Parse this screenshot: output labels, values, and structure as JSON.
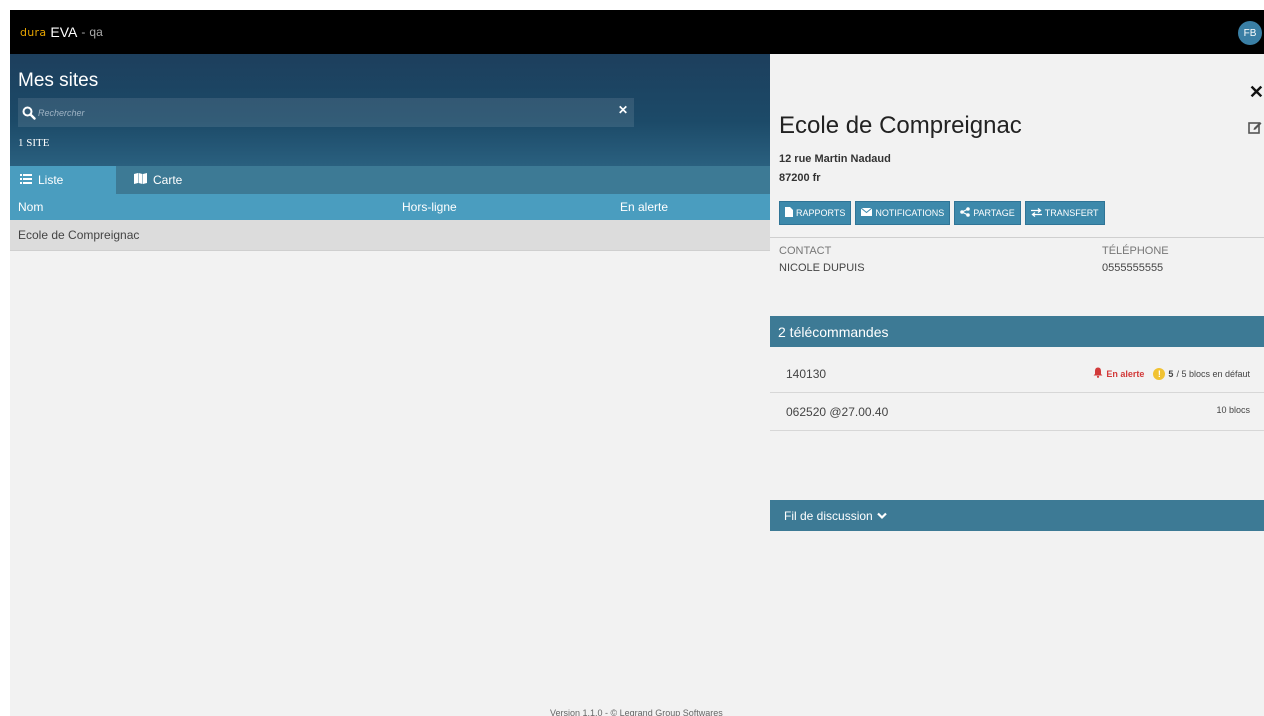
{
  "topbar": {
    "logo_text": "dura",
    "app_name": "EVA",
    "separator": "-",
    "env": "qa",
    "avatar_initials": "FB"
  },
  "sites": {
    "title": "Mes sites",
    "search_placeholder": "Rechercher",
    "search_value": "",
    "count_label": "1 SITE",
    "tabs": [
      {
        "label": "Liste",
        "icon": "list-icon",
        "active": true
      },
      {
        "label": "Carte",
        "icon": "map-icon",
        "active": false
      }
    ],
    "columns": [
      "Nom",
      "Hors-ligne",
      "En alerte"
    ],
    "rows": [
      {
        "name": "Ecole de Compreignac",
        "offline": "",
        "alert": ""
      }
    ],
    "footer": "Version 1.1.0 - © Legrand Group Softwares"
  },
  "detail": {
    "title": "Ecole de Compreignac",
    "address_line1": "12 rue Martin Nadaud",
    "address_line2": "87200 fr",
    "actions": [
      {
        "label": "RAPPORTS",
        "icon": "file-icon"
      },
      {
        "label": "NOTIFICATIONS",
        "icon": "envelope-icon"
      },
      {
        "label": "PARTAGE",
        "icon": "share-icon"
      },
      {
        "label": "TRANSFERT",
        "icon": "transfer-icon"
      }
    ],
    "contact_label": "CONTACT",
    "contact_value": "NICOLE DUPUIS",
    "phone_label": "TÉLÉPHONE",
    "phone_value": "0555555555",
    "remotes_header": "2 télécommandes",
    "remotes": [
      {
        "id": "140130",
        "alert_label": "En alerte",
        "warn_symbol": "!",
        "fault_count": "5",
        "fault_text": "/ 5 blocs en défaut"
      },
      {
        "id": "062520 @27.00.40",
        "blocks": "10 blocs"
      }
    ],
    "discussion_label": "Fil de discussion"
  },
  "colors": {
    "topbar": "#000000",
    "hero": "#1d3f5d",
    "tab_bar": "#3d7a95",
    "accent": "#4a9dbf",
    "alert": "#d23a3a",
    "warning": "#f1c232"
  }
}
